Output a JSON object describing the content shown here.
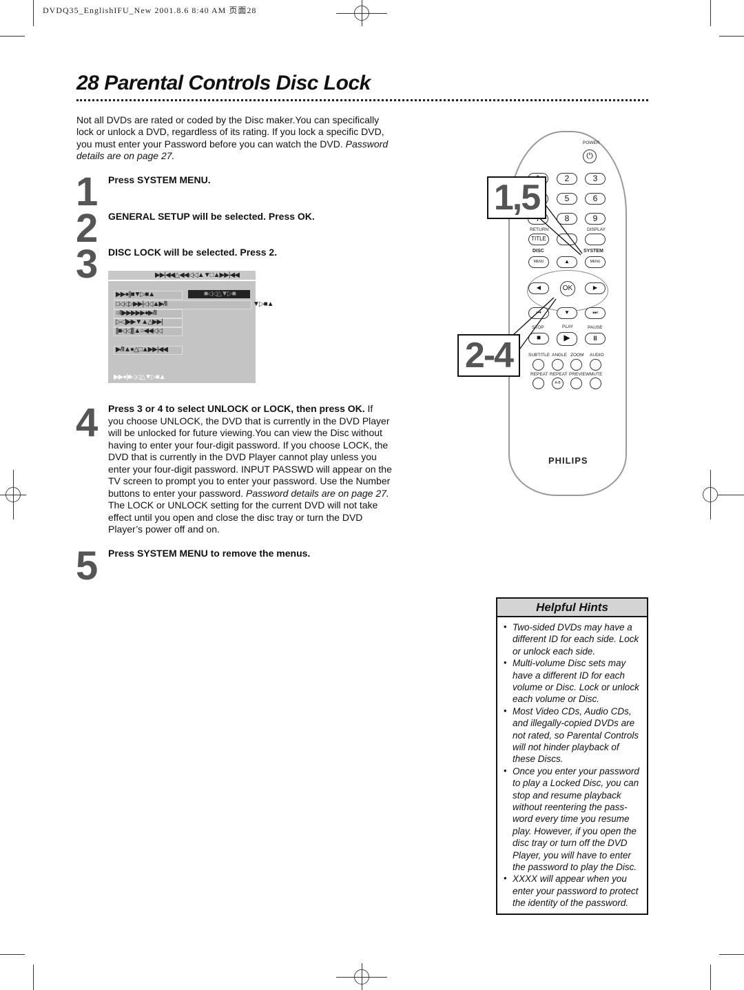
{
  "header_meta": "DVDQ35_EnglishIFU_New  2001.8.6 8:40 AM 页面28",
  "title": "28  Parental Controls Disc Lock",
  "intro": {
    "lines": [
      "Not all DVDs are rated or coded by the Disc maker.You can specifically",
      "lock or unlock a DVD, regardless of its rating. If you lock a specific DVD,",
      "you must enter your Password before you can watch the DVD. "
    ],
    "italic_a": "Password",
    "italic_b": "details are on page 27."
  },
  "steps": [
    {
      "number": "1",
      "text": "Press SYSTEM MENU."
    },
    {
      "number": "2",
      "text": "GENERAL SETUP will be selected. Press OK."
    },
    {
      "number": "3",
      "text": "DISC LOCK will be selected. Press 2."
    },
    {
      "number": "4",
      "bold": "Press 3  or 4  to select UNLOCK or LOCK, then press OK.",
      "lines": [
        " If",
        "you choose UNLOCK, the DVD that is currently in the DVD Player",
        "will be unlocked for future viewing.You can view the Disc without",
        "having to enter your four-digit password. If you choose LOCK, the",
        "DVD that is currently in the DVD Player cannot play unless you",
        "enter your four-digit password. INPUT PASSWD will appear on the",
        "TV screen to prompt you to enter your password. Use the Number",
        "buttons to enter your password. ",
        "The LOCK or UNLOCK setting for the current DVD will not take",
        "effect until you open and close the disc tray or turn the DVD",
        "Player’s power off and on."
      ],
      "italic": "Password details are on page 27."
    },
    {
      "number": "5",
      "text": "Press SYSTEM MENU to remove the menus."
    }
  ],
  "screen_glyphs": {
    "title": "▶▶|◀◀△◀◀◁◁▲▼□▲▶▶|◀◀",
    "rows": [
      "▶▶●||■▼▷■▲",
      "□◁◁▷▶▶|◁◁▲▶/II",
      "○II▶▶▶▶▶●▶/II",
      "▷◁|▶▶▼▲△▶▶|",
      "||■◁◁|||▲○◀◀◁◁",
      "▶/II▲●△□▲▶▶|◀◀"
    ],
    "selected": "■◁◁△▼▷■",
    "value": "▶/II",
    "side": "▼▷■▲",
    "footer": "▶▶●|■◁◁△▼▷■▲"
  },
  "remote": {
    "power": "POWER",
    "numbers": [
      "1",
      "2",
      "3",
      "4",
      "5",
      "6",
      "7",
      "8",
      "9"
    ],
    "return": "RETURN",
    "display": "DISPLAY",
    "title": "TITLE",
    "disc": "DISC",
    "system": "SYSTEM",
    "menu": "MENU",
    "ok": "OK",
    "stop": "STOP",
    "play": "PLAY",
    "pause": "PAUSE",
    "row1": [
      "SUBTITLE",
      "ANGLE",
      "ZOOM",
      "AUDIO"
    ],
    "row2": [
      "REPEAT",
      "REPEAT",
      "PREVIEW",
      "MUTE"
    ],
    "ab": "A-B",
    "brand": "PHILIPS"
  },
  "callouts": [
    "1,5",
    "2-4"
  ],
  "hints": {
    "title": "Helpful Hints",
    "lines": [
      {
        "b": true,
        "t": "Two-sided DVDs may have a"
      },
      {
        "t": "different ID for each side. Lock"
      },
      {
        "t": "or unlock each side."
      },
      {
        "b": true,
        "t": "Multi-volume Disc sets may"
      },
      {
        "t": "have a different ID for each"
      },
      {
        "t": "volume or Disc. Lock or unlock"
      },
      {
        "t": "each volume or Disc."
      },
      {
        "b": true,
        "t": "Most Video CDs, Audio CDs,"
      },
      {
        "t": "and illegally-copied DVDs are"
      },
      {
        "t": "not rated, so Parental Controls"
      },
      {
        "t": "will not hinder playback of"
      },
      {
        "t": "these Discs."
      },
      {
        "b": true,
        "t": "Once you enter your password"
      },
      {
        "t": "to play a Locked Disc, you can"
      },
      {
        "t": "stop and resume playback"
      },
      {
        "t": "without reentering the pass-"
      },
      {
        "t": "word every time you resume"
      },
      {
        "t": "play. However, if you open the"
      },
      {
        "t": "disc tray or turn off the DVD"
      },
      {
        "t": "Player, you will have to enter"
      },
      {
        "t": "the password to play the Disc."
      },
      {
        "b": true,
        "t": "XXXX will appear when you"
      },
      {
        "t": "enter your password to protect"
      },
      {
        "t": "the identity of the password."
      }
    ]
  }
}
